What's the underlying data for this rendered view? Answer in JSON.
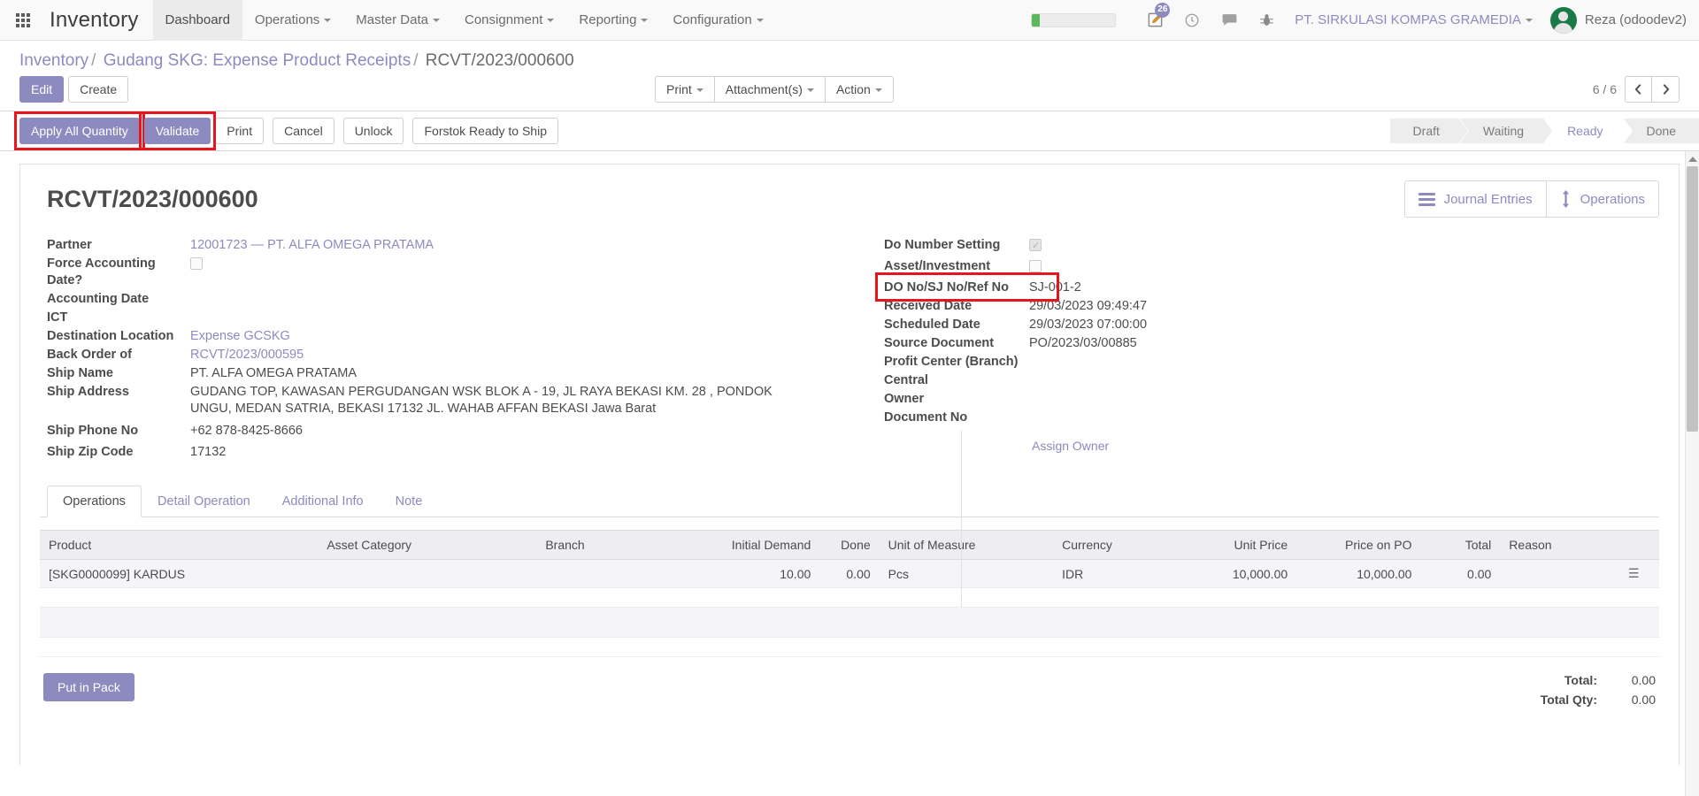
{
  "navbar": {
    "apps_icon": "apps-grid-icon",
    "brand": "Inventory",
    "menus": [
      {
        "label": "Dashboard",
        "has_caret": false,
        "active": true
      },
      {
        "label": "Operations",
        "has_caret": true,
        "active": false
      },
      {
        "label": "Master Data",
        "has_caret": true,
        "active": false
      },
      {
        "label": "Consignment",
        "has_caret": true,
        "active": false
      },
      {
        "label": "Reporting",
        "has_caret": true,
        "active": false
      },
      {
        "label": "Configuration",
        "has_caret": true,
        "active": false
      }
    ],
    "activity_badge": "26",
    "icons": [
      "activity-pencil-icon",
      "clock-icon",
      "messages-icon",
      "bug-icon"
    ],
    "company": "PT. SIRKULASI KOMPAS GRAMEDIA",
    "user": "Reza (odoodev2)",
    "progress_fill_color": "#5cb85c",
    "accent_color": "#8d8ac0"
  },
  "control_panel": {
    "breadcrumb": {
      "root": "Inventory",
      "parent": "Gudang SKG: Expense Product Receipts",
      "current": "RCVT/2023/000600"
    },
    "edit_label": "Edit",
    "create_label": "Create",
    "print_label": "Print",
    "attachments_label": "Attachment(s)",
    "action_label": "Action",
    "pager": "6 / 6",
    "prev_icon": "chevron-left-icon",
    "next_icon": "chevron-right-icon"
  },
  "statusbar": {
    "buttons": [
      {
        "label": "Apply All Quantity",
        "primary": true,
        "highlighted": true
      },
      {
        "label": "Validate",
        "primary": true,
        "highlighted": true
      },
      {
        "label": "Print",
        "primary": false,
        "highlighted": false
      },
      {
        "label": "Cancel",
        "primary": false,
        "highlighted": false
      },
      {
        "label": "Unlock",
        "primary": false,
        "highlighted": false
      },
      {
        "label": "Forstok Ready to Ship",
        "primary": false,
        "highlighted": false
      }
    ],
    "stages": [
      {
        "label": "Draft",
        "active": false
      },
      {
        "label": "Waiting",
        "active": false
      },
      {
        "label": "Ready",
        "active": true
      },
      {
        "label": "Done",
        "active": false
      }
    ],
    "highlight_color": "#e8151c"
  },
  "sheet": {
    "title": "RCVT/2023/000600",
    "stat_buttons": [
      {
        "icon": "journal-lines-icon",
        "label": "Journal Entries"
      },
      {
        "icon": "arrows-vertical-icon",
        "label": "Operations"
      }
    ],
    "left_fields": [
      {
        "label": "Partner",
        "value": "12001723 — PT. ALFA OMEGA PRATAMA",
        "kind": "link"
      },
      {
        "label": "Force Accounting Date?",
        "value": "",
        "kind": "checkbox",
        "checked": false
      },
      {
        "label": "Accounting Date",
        "value": "",
        "kind": "text"
      },
      {
        "label": "ICT",
        "value": "",
        "kind": "text"
      },
      {
        "label": "Destination Location",
        "value": "Expense GCSKG",
        "kind": "link"
      },
      {
        "label": "Back Order of",
        "value": "RCVT/2023/000595",
        "kind": "link"
      },
      {
        "label": "Ship Name",
        "value": "PT. ALFA OMEGA PRATAMA",
        "kind": "text"
      },
      {
        "label": "Ship Address",
        "value": "GUDANG TOP, KAWASAN PERGUDANGAN WSK BLOK A - 19, JL RAYA BEKASI KM. 28 , PONDOK UNGU, MEDAN SATRIA, BEKASI 17132 JL. WAHAB AFFAN BEKASI Jawa Barat",
        "kind": "text"
      },
      {
        "label": "Ship Phone No",
        "value": "+62 878-8425-8666",
        "kind": "text"
      },
      {
        "label": "Ship Zip Code",
        "value": "17132",
        "kind": "text"
      }
    ],
    "right_fields": [
      {
        "label": "Do Number Setting",
        "value": "",
        "kind": "checkbox",
        "checked": true
      },
      {
        "label": "Asset/Investment",
        "value": "",
        "kind": "checkbox",
        "checked": false
      },
      {
        "label": "DO No/SJ No/Ref No",
        "value": "SJ-001-2",
        "kind": "text",
        "highlighted": true
      },
      {
        "label": "Received Date",
        "value": "29/03/2023 09:49:47",
        "kind": "text"
      },
      {
        "label": "Scheduled Date",
        "value": "29/03/2023 07:00:00",
        "kind": "text"
      },
      {
        "label": "Source Document",
        "value": "PO/2023/03/00885",
        "kind": "text"
      },
      {
        "label": "Profit Center (Branch)",
        "value": "",
        "kind": "text"
      },
      {
        "label": "Central",
        "value": "",
        "kind": "text"
      },
      {
        "label": "Owner",
        "value": "",
        "kind": "text"
      },
      {
        "label": "Document No",
        "value": "",
        "kind": "text"
      }
    ],
    "assign_owner_label": "Assign Owner"
  },
  "notebook": {
    "tabs": [
      {
        "label": "Operations",
        "active": true
      },
      {
        "label": "Detail Operation",
        "active": false
      },
      {
        "label": "Additional Info",
        "active": false
      },
      {
        "label": "Note",
        "active": false
      }
    ],
    "table": {
      "columns": [
        "Product",
        "Asset Category",
        "Branch",
        "Initial Demand",
        "Done",
        "Unit of Measure",
        "Currency",
        "Unit Price",
        "Price on PO",
        "Total",
        "Reason"
      ],
      "rows": [
        {
          "product": "[SKG0000099] KARDUS",
          "asset_category": "",
          "branch": "",
          "initial_demand": "10.00",
          "done": "0.00",
          "unit_of_measure": "Pcs",
          "currency": "IDR",
          "unit_price": "10,000.00",
          "price_on_po": "10,000.00",
          "total": "0.00",
          "reason": "",
          "options_icon": "list-options-icon"
        }
      ]
    },
    "put_in_pack_label": "Put in Pack",
    "totals": [
      {
        "label": "Total:",
        "value": "0.00"
      },
      {
        "label": "Total Qty:",
        "value": "0.00"
      }
    ]
  }
}
